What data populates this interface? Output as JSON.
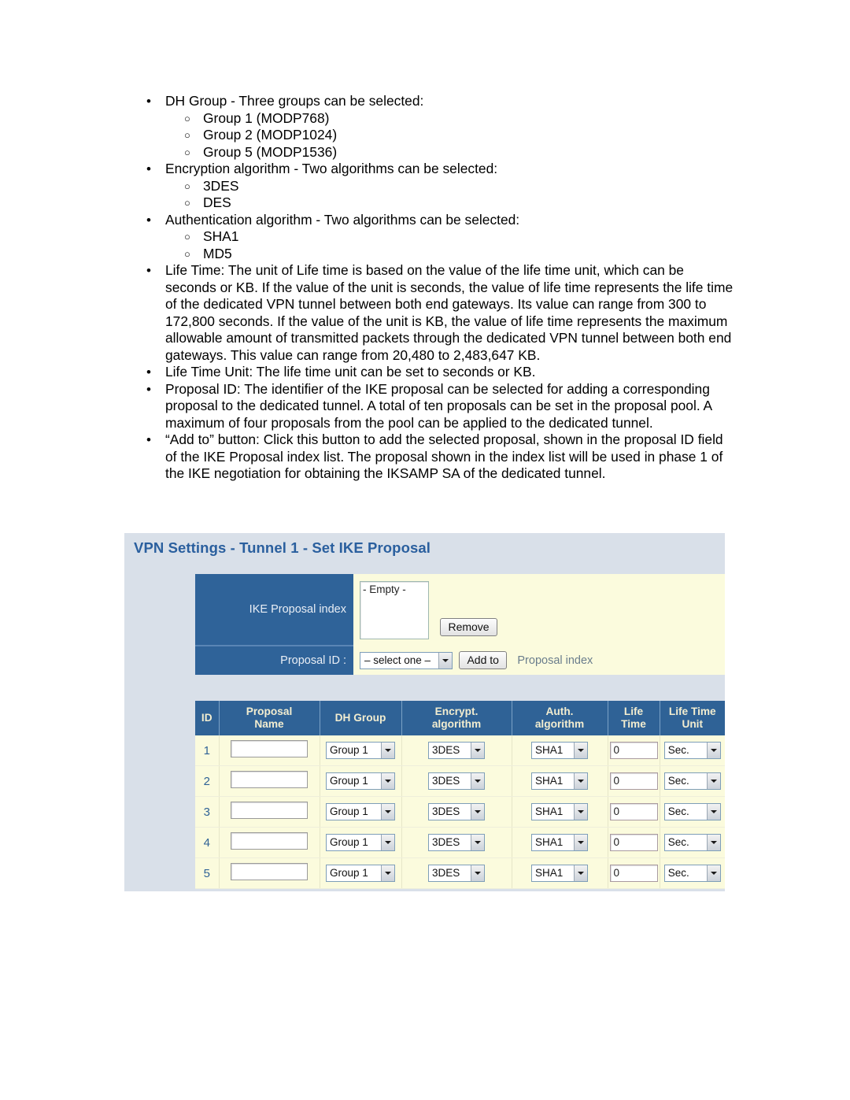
{
  "document": {
    "bullets": [
      {
        "text": "DH Group - Three groups can be selected:",
        "sub": [
          "Group 1 (MODP768)",
          "Group 2 (MODP1024)",
          "Group 5 (MODP1536)"
        ]
      },
      {
        "text": "Encryption algorithm - Two algorithms can be selected:",
        "sub": [
          "3DES",
          "DES"
        ]
      },
      {
        "text": "Authentication algorithm - Two algorithms can be selected:",
        "sub": [
          "SHA1",
          "MD5"
        ]
      },
      {
        "text": "Life Time: The unit of Life time is based on the value of the life time unit, which can be seconds or KB. If the value of the unit is seconds, the value of life time represents the life time of the dedicated VPN tunnel between both end gateways. Its value can range from 300 to 172,800 seconds. If the value of the unit is KB, the value of life time represents the maximum allowable amount of transmitted packets through the dedicated VPN tunnel between both end gateways. This value can range from 20,480 to 2,483,647 KB.",
        "sub": []
      },
      {
        "text": "Life Time Unit: The life time unit can be set to seconds or KB.",
        "sub": []
      },
      {
        "text": "Proposal ID: The identifier of the IKE proposal can be selected for adding a corresponding proposal to the dedicated tunnel. A total of ten proposals can be set in the proposal pool. A maximum of four proposals from the pool can be applied to the dedicated tunnel.",
        "sub": []
      },
      {
        "text": "“Add to” button: Click this button to add the selected proposal, shown in the proposal ID field of the IKE Proposal index list. The proposal shown in the index list will be used in phase 1 of the IKE negotiation for obtaining the IKSAMP SA of the dedicated tunnel.",
        "sub": []
      }
    ],
    "bullet_glyph": "•",
    "sub_bullet_glyph": "○"
  },
  "panel": {
    "title": "VPN Settings - Tunnel 1 - Set IKE Proposal",
    "colors": {
      "panel_bg": "#d9e0e9",
      "title": "#2a5f9e",
      "label_cell_bg": "#2f6399",
      "value_cell_bg": "#fbfbdd",
      "table_header_bg": "#2f6296",
      "table_header_text": "#f2edd0"
    },
    "settings": {
      "ike_proposal_index_label": "IKE Proposal index",
      "listbox_value": "- Empty -",
      "remove_button": "Remove",
      "proposal_id_label": "Proposal ID :",
      "proposal_id_value": "– select one –",
      "add_to_button": "Add to",
      "proposal_index_text": "Proposal index"
    },
    "table": {
      "headers": [
        "ID",
        "Proposal Name",
        "DH Group",
        "Encrypt. algorithm",
        "Auth. algorithm",
        "Life Time",
        "Life Time Unit"
      ],
      "headers_lines": [
        [
          "ID"
        ],
        [
          "Proposal",
          "Name"
        ],
        [
          "DH Group"
        ],
        [
          "Encrypt.",
          "algorithm"
        ],
        [
          "Auth.",
          "algorithm"
        ],
        [
          "Life",
          "Time"
        ],
        [
          "Life Time",
          "Unit"
        ]
      ],
      "rows": [
        {
          "id": "1",
          "name": "",
          "dh_group": "Group 1",
          "encrypt": "3DES",
          "auth": "SHA1",
          "life_time": "0",
          "life_time_unit": "Sec."
        },
        {
          "id": "2",
          "name": "",
          "dh_group": "Group 1",
          "encrypt": "3DES",
          "auth": "SHA1",
          "life_time": "0",
          "life_time_unit": "Sec."
        },
        {
          "id": "3",
          "name": "",
          "dh_group": "Group 1",
          "encrypt": "3DES",
          "auth": "SHA1",
          "life_time": "0",
          "life_time_unit": "Sec."
        },
        {
          "id": "4",
          "name": "",
          "dh_group": "Group 1",
          "encrypt": "3DES",
          "auth": "SHA1",
          "life_time": "0",
          "life_time_unit": "Sec."
        },
        {
          "id": "5",
          "name": "",
          "dh_group": "Group 1",
          "encrypt": "3DES",
          "auth": "SHA1",
          "life_time": "0",
          "life_time_unit": "Sec."
        }
      ]
    }
  }
}
